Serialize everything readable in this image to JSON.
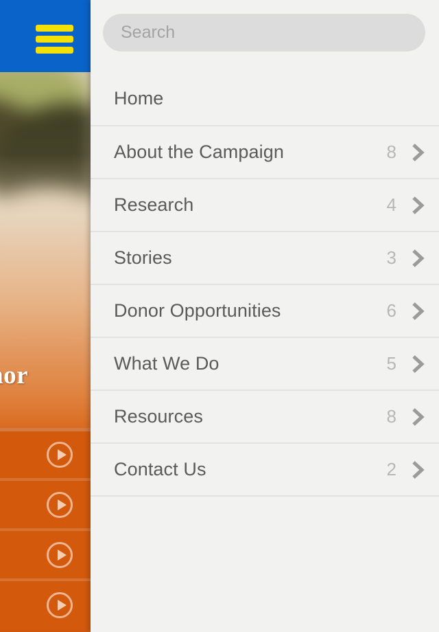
{
  "topbar": {
    "menu_icon": "hamburger-menu-icon",
    "bg_color": "#0a63c9",
    "icon_color": "#f2e007"
  },
  "hero": {
    "title_partial": "donor",
    "overlay_color": "#da6a1e"
  },
  "video_cards": [
    {
      "icon": "play-circle-icon"
    },
    {
      "icon": "play-circle-icon"
    },
    {
      "icon": "play-circle-icon"
    },
    {
      "icon": "play-circle-icon"
    }
  ],
  "drawer": {
    "search": {
      "placeholder": "Search",
      "value": "",
      "icon": "search-input"
    },
    "menu": [
      {
        "label": "Home",
        "count": ""
      },
      {
        "label": "About the Campaign",
        "count": "8"
      },
      {
        "label": "Research",
        "count": "4"
      },
      {
        "label": "Stories",
        "count": "3"
      },
      {
        "label": "Donor Opportunities",
        "count": "6"
      },
      {
        "label": "What We Do",
        "count": "5"
      },
      {
        "label": "Resources",
        "count": "8"
      },
      {
        "label": "Contact Us",
        "count": "2"
      }
    ],
    "chevron_icon": "chevron-right-icon",
    "bg_color": "#f2f2f1",
    "divider_color": "#e2e2e1",
    "label_color": "#5a5a5a",
    "count_color": "#b7b7b7"
  }
}
